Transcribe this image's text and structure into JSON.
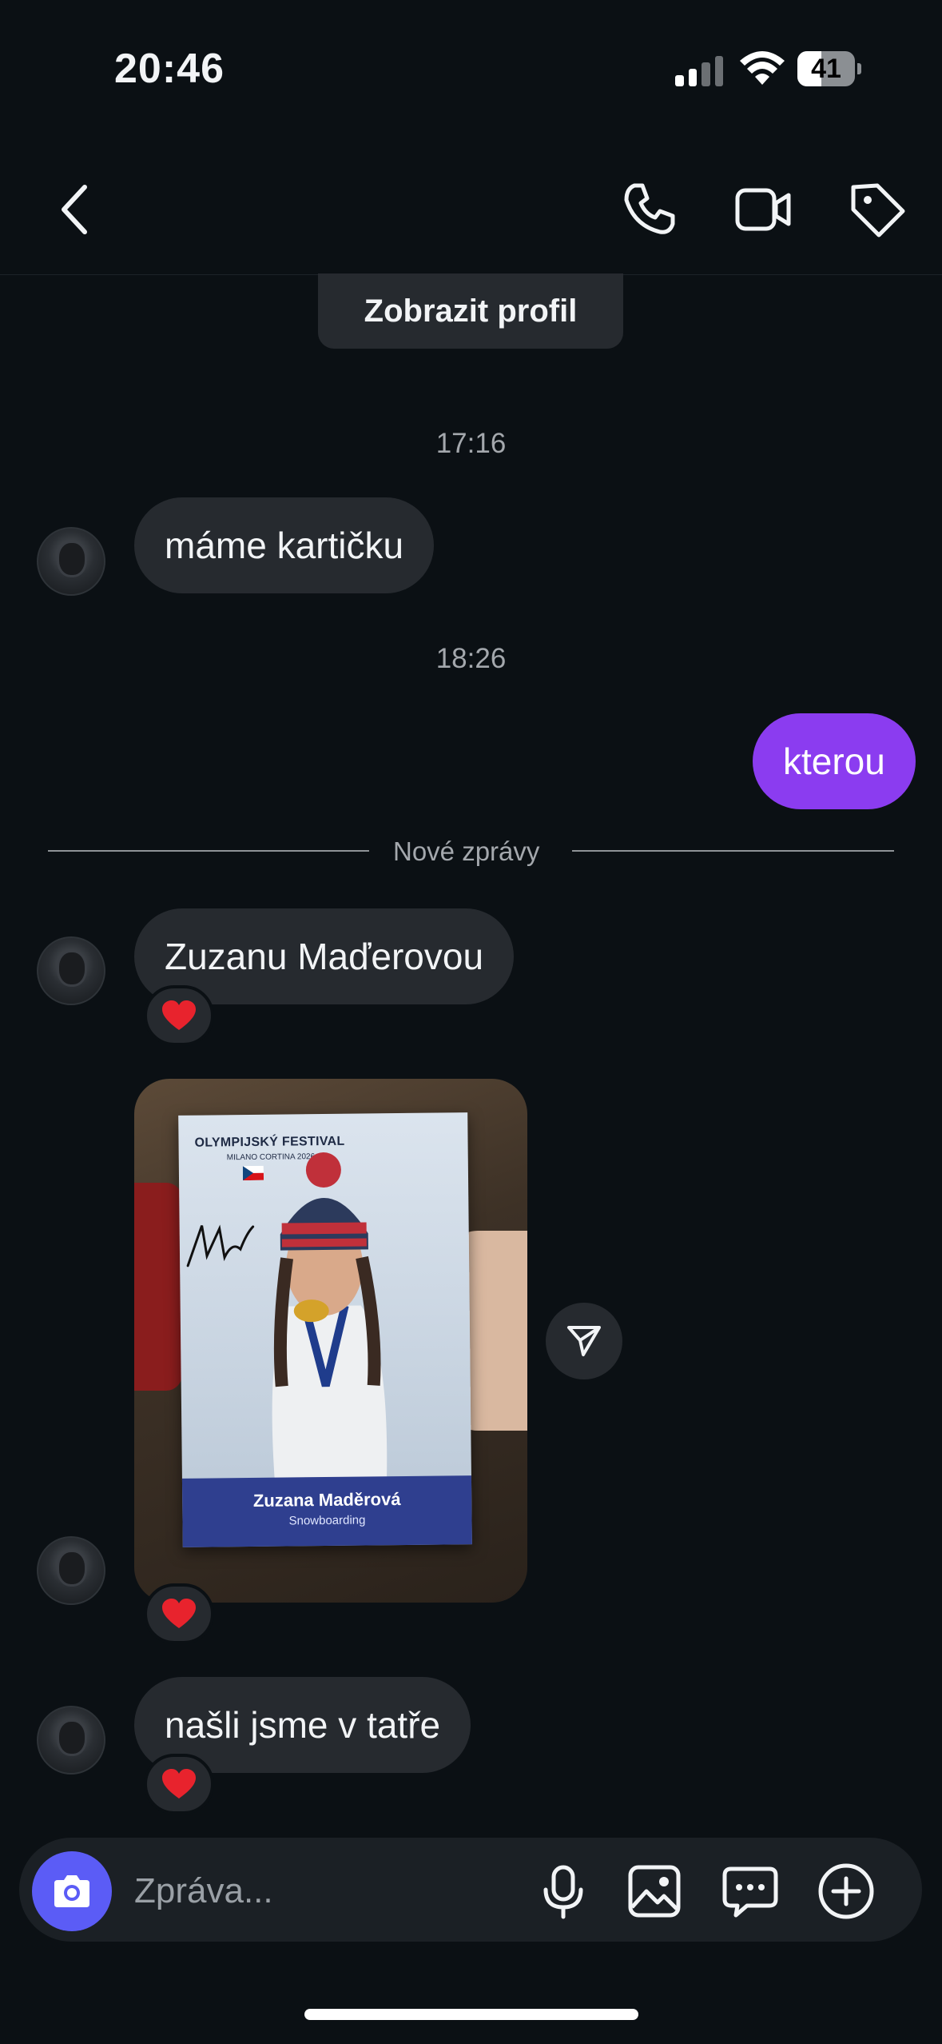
{
  "status_bar": {
    "time": "20:46",
    "battery": "41",
    "battery_level": 0.41,
    "signal_bars_active": 2,
    "signal_bars_total": 4
  },
  "header": {
    "back_icon": "chevron-left-icon",
    "actions": [
      {
        "icon": "phone-icon"
      },
      {
        "icon": "video-camera-icon"
      },
      {
        "icon": "tag-icon"
      }
    ]
  },
  "profile_button": "Zobrazit profil",
  "messages": {
    "timestamp_1": "17:16",
    "msg_1": "máme kartičku",
    "timestamp_2": "18:26",
    "msg_2": "kterou",
    "new_messages_divider": "Nové zprávy",
    "msg_3": "Zuzanu Maďerovou",
    "msg_3_reaction": "❤️",
    "photo": {
      "card_title": "OLYMPIJSKÝ FESTIVAL",
      "card_subtitle": "MILANO CORTINA 2026",
      "card_name": "Zuzana Maděrová",
      "card_sport": "Snowboarding"
    },
    "photo_reaction": "❤️",
    "msg_4": "našli jsme v tatře",
    "msg_4_reaction": "❤️"
  },
  "composer": {
    "placeholder": "Zpráva...",
    "icons": [
      "camera-icon",
      "microphone-icon",
      "image-icon",
      "chat-bubble-icon",
      "plus-circle-icon"
    ]
  },
  "colors": {
    "background": "#0b1014",
    "incoming_bubble": "#262a2f",
    "outgoing_bubble": "#8b3cf0",
    "camera_button": "#5b5cf6"
  }
}
